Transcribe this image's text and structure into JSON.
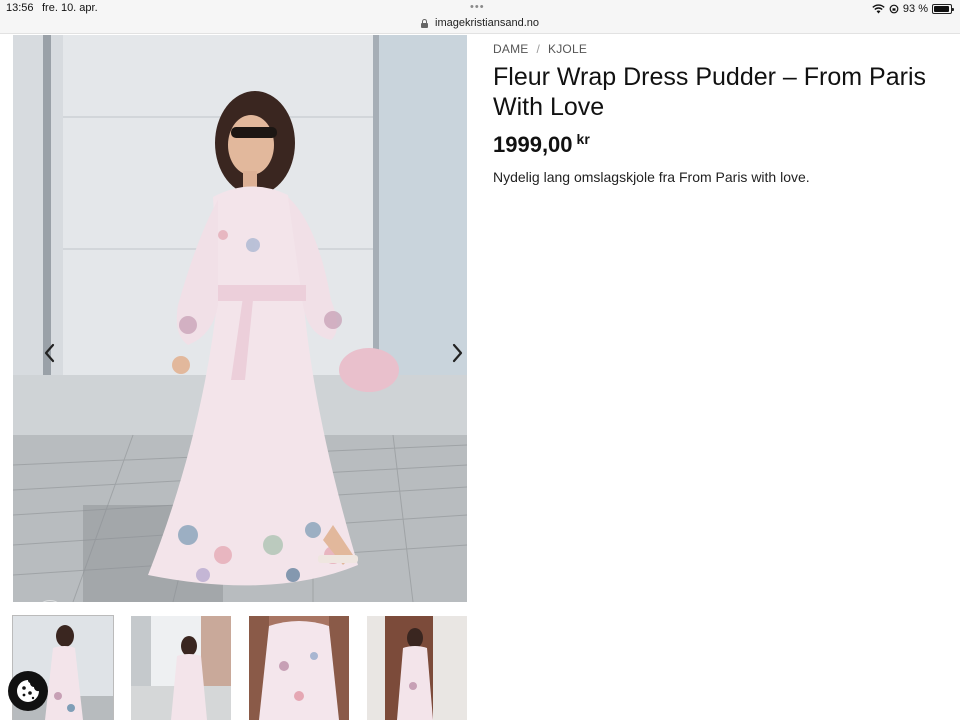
{
  "statusbar": {
    "time": "13:56",
    "date": "fre. 10. apr.",
    "dots": "•••",
    "url": "imagekristiansand.no",
    "battery_text": "93 %",
    "battery_level": 0.93
  },
  "breadcrumb": {
    "items": [
      "DAME",
      "KJOLE"
    ],
    "separator": "/"
  },
  "product": {
    "title": "Fleur Wrap Dress Pudder – From Paris With Love",
    "price": "1999,00",
    "currency": "kr",
    "description": "Nydelig lang omslagskjole fra From Paris with love."
  },
  "gallery": {
    "thumbnail_count": 4,
    "active_index": 0
  },
  "colors": {
    "dress": "#f3e4ea",
    "accent_text": "#111111"
  }
}
